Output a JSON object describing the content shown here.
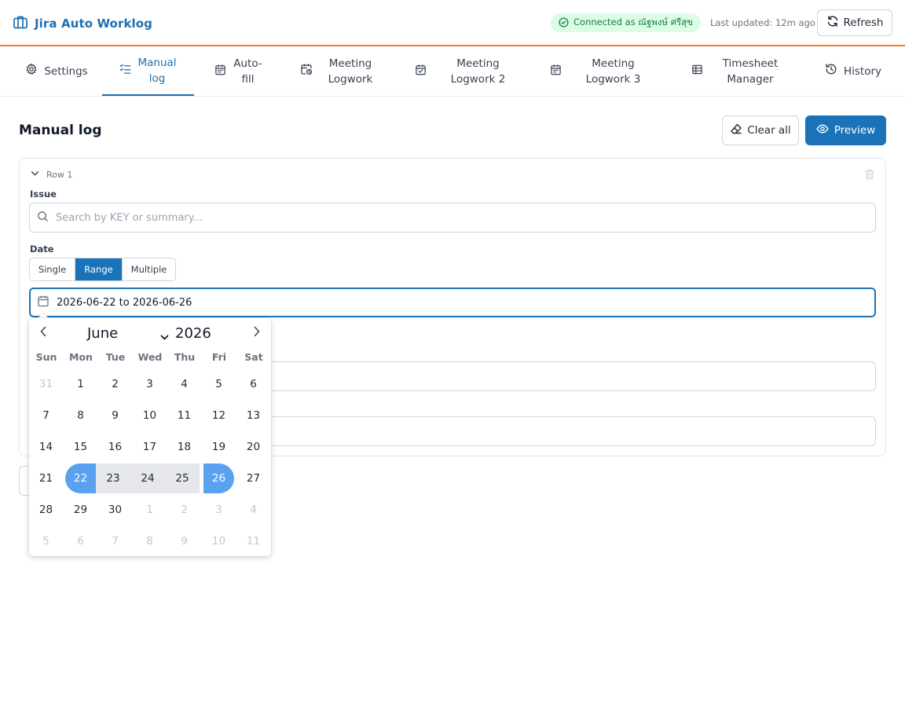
{
  "header": {
    "title": "Jira Auto Worklog",
    "status": "Connected as ณัฐพงษ์ ศรีสุข",
    "last_updated": "Last updated: 12m ago",
    "refresh_label": "Refresh"
  },
  "tabs": [
    {
      "label": "Settings",
      "icon": "gear-icon"
    },
    {
      "label": "Manual log",
      "icon": "checklist-icon",
      "active": true
    },
    {
      "label": "Auto-fill",
      "icon": "calendar-icon"
    },
    {
      "label": "Meeting Logwork",
      "icon": "calendar-clock-icon"
    },
    {
      "label": "Meeting Logwork 2",
      "icon": "calendar-check-icon"
    },
    {
      "label": "Meeting Logwork 3",
      "icon": "calendar-icon"
    },
    {
      "label": "Timesheet Manager",
      "icon": "table-icon"
    },
    {
      "label": "History",
      "icon": "history-icon"
    }
  ],
  "main": {
    "title": "Manual log",
    "clear_label": "Clear all",
    "preview_label": "Preview",
    "row": {
      "title": "Row 1",
      "issue_label": "Issue",
      "issue_placeholder": "Search by KEY or summary...",
      "date_label": "Date",
      "date_modes": [
        "Single",
        "Range",
        "Multiple"
      ],
      "selected_mode": "Range",
      "date_value": "2026-06-22 to 2026-06-26"
    }
  },
  "calendar": {
    "month": "June",
    "year": "2026",
    "weekdays": [
      "Sun",
      "Mon",
      "Tue",
      "Wed",
      "Thu",
      "Fri",
      "Sat"
    ],
    "weeks": [
      [
        "31",
        "1",
        "2",
        "3",
        "4",
        "5",
        "6"
      ],
      [
        "7",
        "8",
        "9",
        "10",
        "11",
        "12",
        "13"
      ],
      [
        "14",
        "15",
        "16",
        "17",
        "18",
        "19",
        "20"
      ],
      [
        "21",
        "22",
        "23",
        "24",
        "25",
        "26",
        "27"
      ],
      [
        "28",
        "29",
        "30",
        "1",
        "2",
        "3",
        "4"
      ],
      [
        "5",
        "6",
        "7",
        "8",
        "9",
        "10",
        "11"
      ]
    ],
    "range_start": "22",
    "range_end": "26"
  },
  "colors": {
    "accent": "#1a73b8",
    "header_border": "#ea7a2c",
    "status_bg": "#dcfce7",
    "status_text": "#15803d",
    "range_endpoint": "#5aa1f0",
    "range_fill": "#e5e7eb"
  }
}
